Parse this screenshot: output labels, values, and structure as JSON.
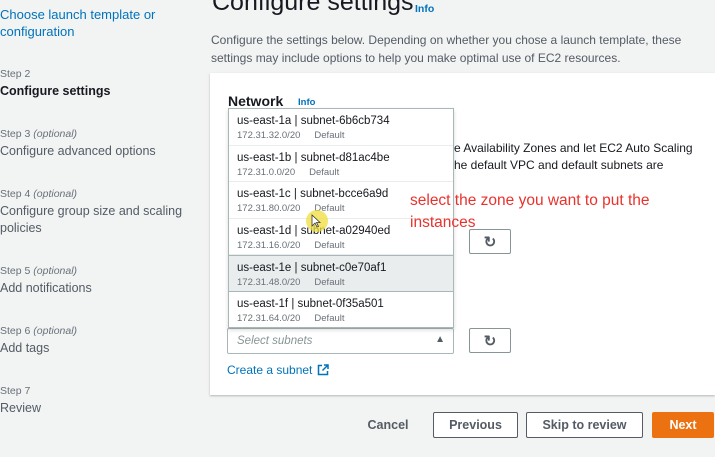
{
  "nav": {
    "prev_link": "Choose launch template or configuration",
    "steps": [
      {
        "num": "Step 2",
        "optional": "",
        "title": "Configure settings"
      },
      {
        "num": "Step 3",
        "optional": "(optional)",
        "title": "Configure advanced options"
      },
      {
        "num": "Step 4",
        "optional": "(optional)",
        "title": "Configure group size and scaling policies"
      },
      {
        "num": "Step 5",
        "optional": "(optional)",
        "title": "Add notifications"
      },
      {
        "num": "Step 6",
        "optional": "(optional)",
        "title": "Add tags"
      },
      {
        "num": "Step 7",
        "optional": "",
        "title": "Review"
      }
    ]
  },
  "header": {
    "title": "Configure settings",
    "info": "Info",
    "description": "Configure the settings below. Depending on whether you chose a launch template, these settings may include options to help you make optimal use of EC2 resources."
  },
  "network": {
    "title": "Network",
    "info": "Info",
    "text": "e Availability Zones and let EC2 Auto Scaling he default VPC and default subnets are",
    "select_placeholder": "Select subnets",
    "create_subnet": "Create a subnet",
    "subnets": [
      {
        "name": "us-east-1a | subnet-6b6cb734",
        "cidr": "172.31.32.0/20",
        "tag": "Default"
      },
      {
        "name": "us-east-1b | subnet-d81ac4be",
        "cidr": "172.31.0.0/20",
        "tag": "Default"
      },
      {
        "name": "us-east-1c | subnet-bcce6a9d",
        "cidr": "172.31.80.0/20",
        "tag": "Default"
      },
      {
        "name": "us-east-1d | subnet-a02940ed",
        "cidr": "172.31.16.0/20",
        "tag": "Default"
      },
      {
        "name": "us-east-1e | subnet-c0e70af1",
        "cidr": "172.31.48.0/20",
        "tag": "Default"
      },
      {
        "name": "us-east-1f | subnet-0f35a501",
        "cidr": "172.31.64.0/20",
        "tag": "Default"
      }
    ]
  },
  "annotation": "select the zone you want to put the instances",
  "footer": {
    "cancel": "Cancel",
    "previous": "Previous",
    "skip": "Skip to review",
    "next": "Next"
  },
  "colors": {
    "link": "#0073bb",
    "primary_button": "#ec7211",
    "annotation": "#e8322d"
  }
}
